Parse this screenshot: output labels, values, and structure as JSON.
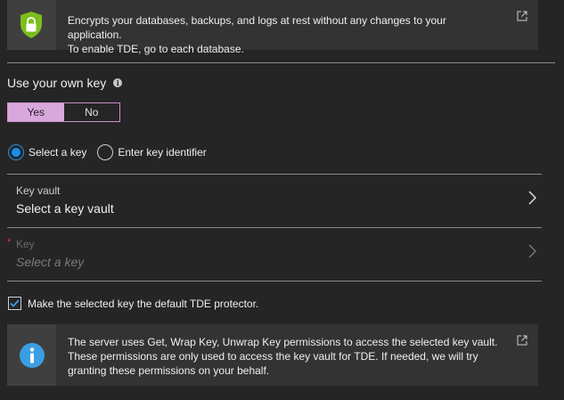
{
  "tde_banner": {
    "text": "Encrypts your databases, backups, and logs at rest without any changes to your application.\nTo enable TDE, go to each database.",
    "icon": "shield-lock-icon",
    "link_icon": "external-link-icon"
  },
  "own_key": {
    "title": "Use your own key",
    "info_icon": "info-icon",
    "yes_label": "Yes",
    "no_label": "No",
    "selected": "Yes"
  },
  "key_source": {
    "options": [
      {
        "label": "Select a key",
        "checked": true
      },
      {
        "label": "Enter key identifier",
        "checked": false
      }
    ]
  },
  "key_vault": {
    "label": "Key vault",
    "value": "Select a key vault"
  },
  "key": {
    "required_marker": "*",
    "label": "Key",
    "placeholder": "Select a key"
  },
  "default_protector": {
    "label": "Make the selected key the default TDE protector.",
    "checked": true
  },
  "permissions_banner": {
    "text": "The server uses Get, Wrap Key, Unwrap Key permissions to access the selected key vault.\nThese permissions are only used to access the key vault for TDE. If needed, we will try\ngranting these permissions on your behalf.",
    "icon": "info-circle-icon",
    "link_icon": "external-link-icon"
  },
  "colors": {
    "background": "#252526",
    "accent": "#1a8fe8",
    "toggle_selected": "#d8a8dc",
    "shield_green": "#7cbf1c",
    "required": "#e03c3c"
  }
}
